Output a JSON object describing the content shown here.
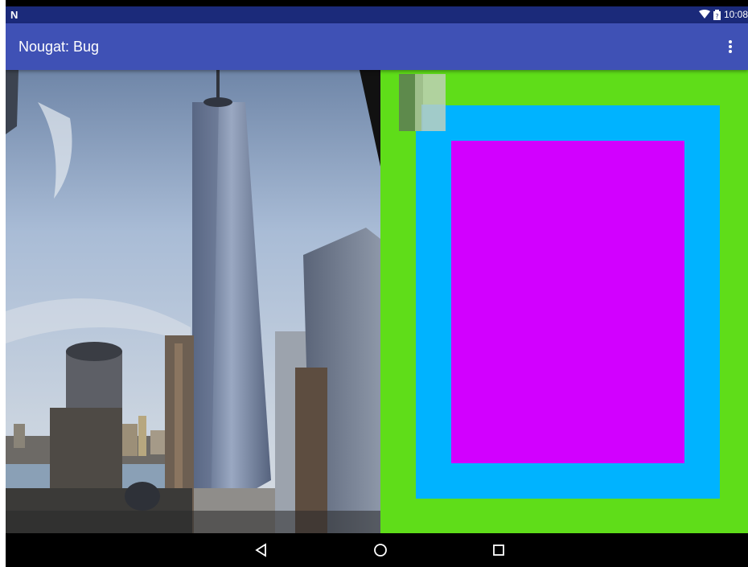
{
  "status_bar": {
    "notification_icon": "N",
    "wifi_icon": "wifi-icon",
    "battery_icon": "battery-icon",
    "time": "10:08"
  },
  "app_bar": {
    "title": "Nougat: Bug",
    "overflow_icon": "more-vert-icon"
  },
  "content": {
    "photo_subject": "city skyline with tall glass tower",
    "panel_colors": {
      "outer": "#5fdd19",
      "middle": "#00b3ff",
      "inner": "#d200ff"
    }
  },
  "nav_bar": {
    "back_icon": "back-triangle-icon",
    "home_icon": "home-circle-icon",
    "recents_icon": "recents-square-icon"
  },
  "colors": {
    "status_bar": "#1b2a7a",
    "app_bar": "#3f51b5",
    "nav_bar": "#000000"
  }
}
